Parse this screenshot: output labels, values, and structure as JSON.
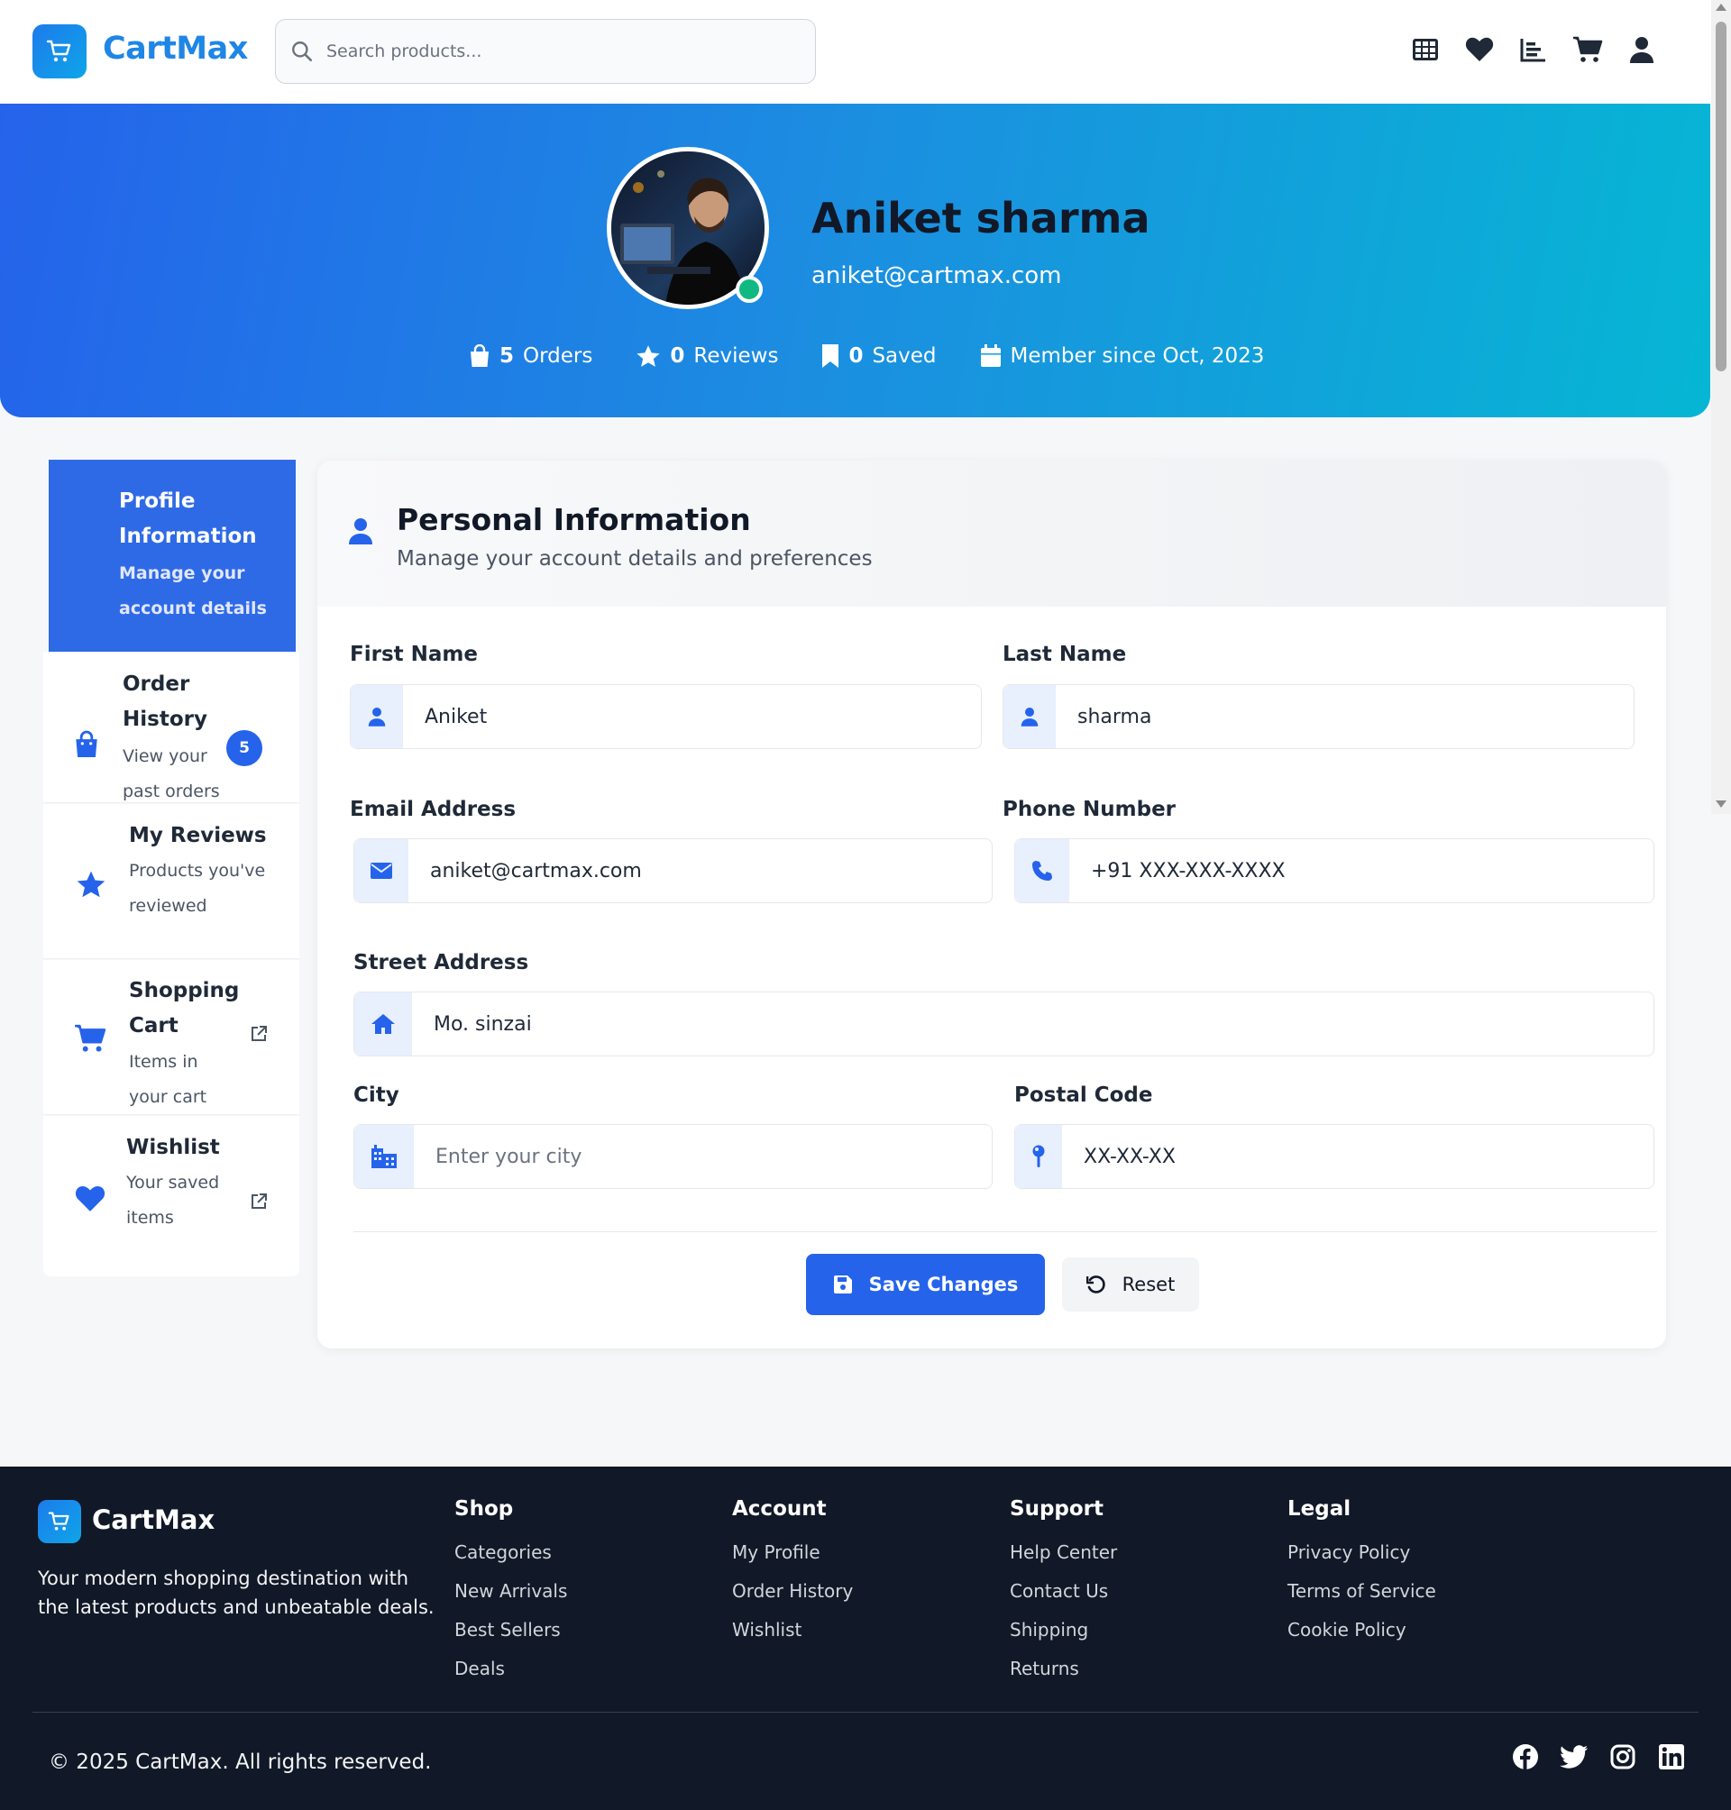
{
  "header": {
    "brand": "CartMax",
    "search_placeholder": "Search products...",
    "nav_icons": [
      "grid-icon",
      "heart-icon",
      "chart-icon",
      "cart-icon",
      "user-icon"
    ]
  },
  "profile": {
    "name": "Aniket sharma",
    "email": "aniket@cartmax.com",
    "stats": {
      "orders_count": "5",
      "orders_label": "Orders",
      "reviews_count": "0",
      "reviews_label": "Reviews",
      "saved_count": "0",
      "saved_label": "Saved",
      "member_since": "Member since Oct, 2023"
    }
  },
  "sidebar": {
    "items": [
      {
        "title": "Profile Information",
        "subtitle": "Manage your account details",
        "icon": "user-icon",
        "active": true
      },
      {
        "title": "Order History",
        "subtitle": "View your past orders",
        "icon": "bag-icon",
        "badge": "5"
      },
      {
        "title": "My Reviews",
        "subtitle": "Products you've reviewed",
        "icon": "star-icon"
      },
      {
        "title": "Shopping Cart",
        "subtitle": "Items in your cart",
        "icon": "cart-icon",
        "external": true
      },
      {
        "title": "Wishlist",
        "subtitle": "Your saved items",
        "icon": "heart-icon",
        "external": true
      }
    ]
  },
  "form": {
    "title": "Personal Information",
    "subtitle": "Manage your account details and preferences",
    "first_name": {
      "label": "First Name",
      "value": "Aniket"
    },
    "last_name": {
      "label": "Last Name",
      "value": "sharma"
    },
    "email": {
      "label": "Email Address",
      "value": "aniket@cartmax.com"
    },
    "phone": {
      "label": "Phone Number",
      "value": "+91 XXX-XXX-XXXX"
    },
    "street": {
      "label": "Street Address",
      "value": "Mo. sinzai"
    },
    "city": {
      "label": "City",
      "value": "",
      "placeholder": "Enter your city"
    },
    "postal": {
      "label": "Postal Code",
      "value": "XX-XX-XX"
    },
    "save_label": "Save Changes",
    "reset_label": "Reset"
  },
  "footer": {
    "brand": "CartMax",
    "description": "Your modern shopping destination with the latest products and unbeatable deals.",
    "columns": [
      {
        "title": "Shop",
        "links": [
          "Categories",
          "New Arrivals",
          "Best Sellers",
          "Deals"
        ]
      },
      {
        "title": "Account",
        "links": [
          "My Profile",
          "Order History",
          "Wishlist"
        ]
      },
      {
        "title": "Support",
        "links": [
          "Help Center",
          "Contact Us",
          "Shipping",
          "Returns"
        ]
      },
      {
        "title": "Legal",
        "links": [
          "Privacy Policy",
          "Terms of Service",
          "Cookie Policy"
        ]
      }
    ],
    "copyright": "© 2025 CartMax. All rights reserved.",
    "socials": [
      "facebook-icon",
      "twitter-icon",
      "instagram-icon",
      "linkedin-icon"
    ]
  },
  "colors": {
    "primary": "#2563eb",
    "brand": "#1f86e6",
    "hero_start": "#2563eb",
    "hero_end": "#06b6d4",
    "online": "#10b981",
    "footer_bg": "#111827"
  }
}
